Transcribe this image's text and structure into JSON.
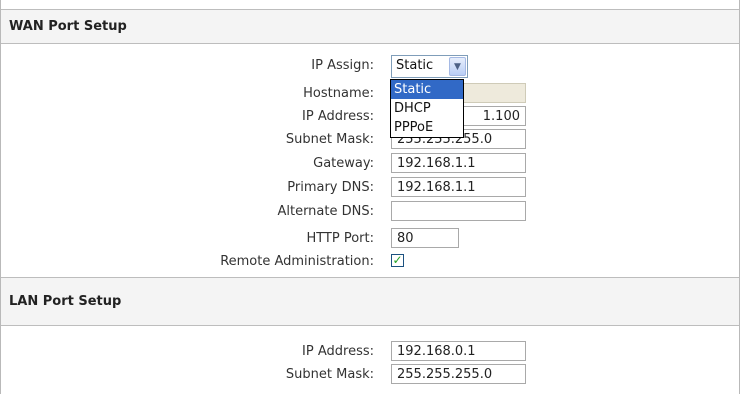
{
  "wan": {
    "title": "WAN Port Setup",
    "ip_assign_label": "IP Assign:",
    "ip_assign_value": "Static",
    "ip_assign_options": [
      "Static",
      "DHCP",
      "PPPoE"
    ],
    "hostname_label": "Hostname:",
    "hostname_value": "",
    "ip_address_label": "IP Address:",
    "ip_address_value": "1.100",
    "subnet_mask_label": "Subnet Mask:",
    "subnet_mask_value": "255.255.255.0",
    "gateway_label": "Gateway:",
    "gateway_value": "192.168.1.1",
    "primary_dns_label": "Primary DNS:",
    "primary_dns_value": "192.168.1.1",
    "alternate_dns_label": "Alternate DNS:",
    "alternate_dns_value": "",
    "http_port_label": "HTTP Port:",
    "http_port_value": "80",
    "remote_admin_label": "Remote Administration:",
    "remote_admin_checked": "✓"
  },
  "lan": {
    "title": "LAN Port Setup",
    "ip_address_label": "IP Address:",
    "ip_address_value": "192.168.0.1",
    "subnet_mask_label": "Subnet Mask:",
    "subnet_mask_value": "255.255.255.0"
  }
}
